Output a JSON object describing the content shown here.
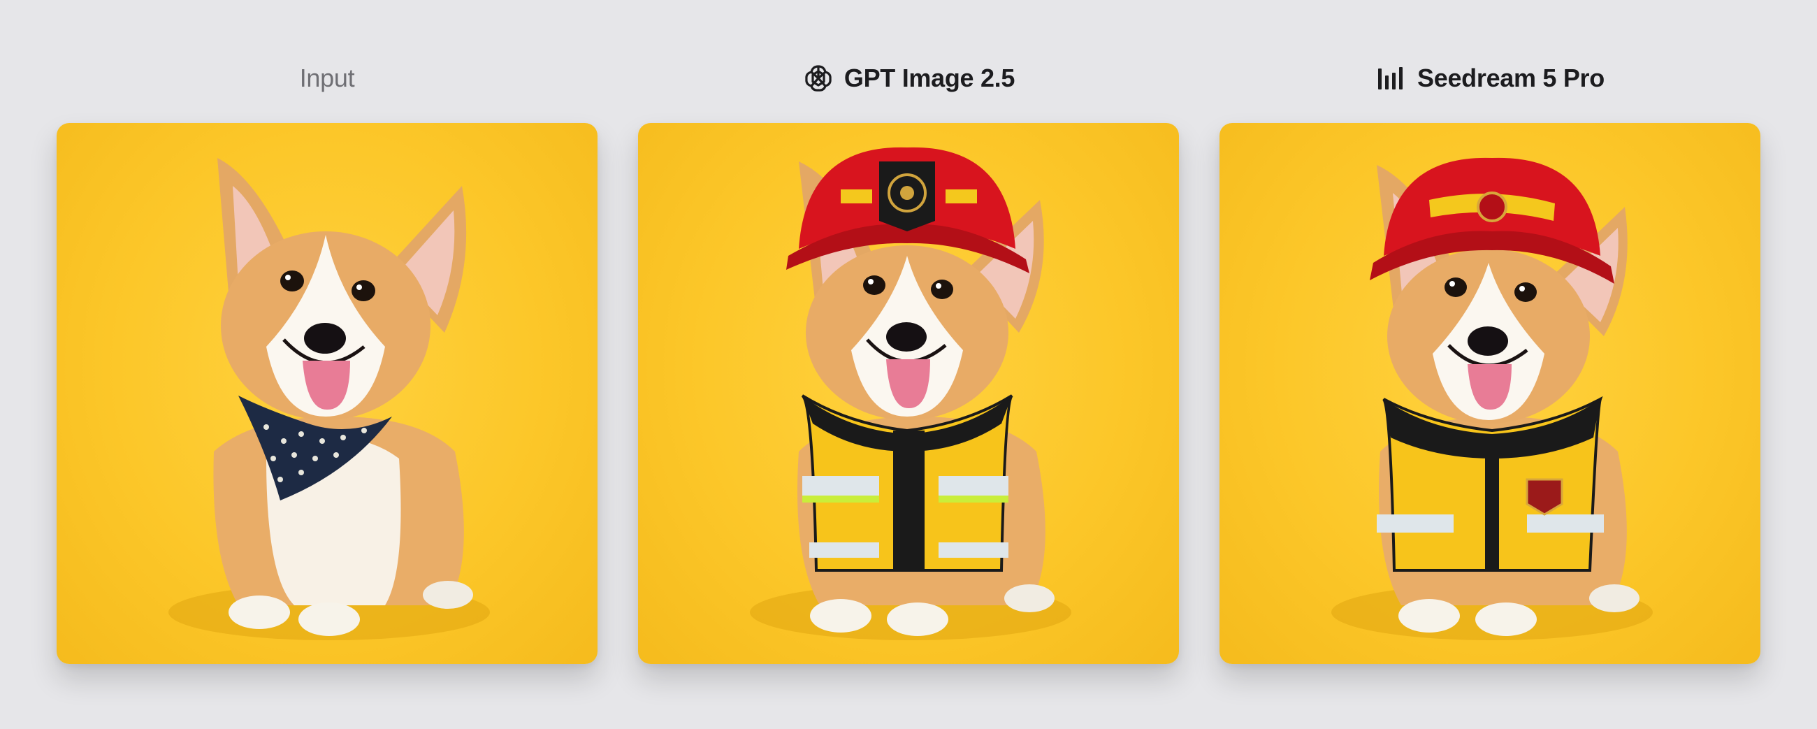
{
  "columns": [
    {
      "id": "input",
      "title": "Input",
      "icon": null,
      "image_subject": "corgi with bandana"
    },
    {
      "id": "gpt",
      "title": "GPT Image 2.5",
      "icon": "openai-logo-icon",
      "image_subject": "corgi in firefighter outfit"
    },
    {
      "id": "seedream",
      "title": "Seedream 5 Pro",
      "icon": "seedream-bars-icon",
      "image_subject": "corgi in firefighter outfit"
    }
  ],
  "colors": {
    "page_background": "#e6e6e9",
    "card_background": "#fcc729",
    "helmet_red": "#d8141e",
    "coat_yellow": "#f7c41b"
  }
}
